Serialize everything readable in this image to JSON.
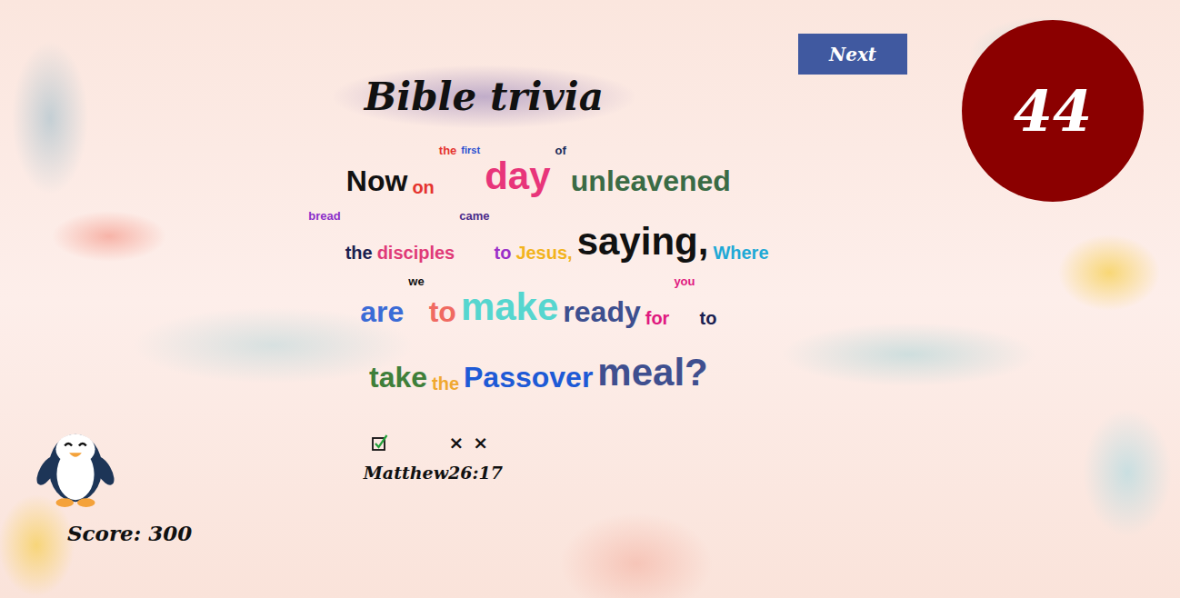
{
  "title": "Bible trivia",
  "next_button": "Next",
  "timer": "44",
  "verse": {
    "lines": [
      [
        {
          "text": "Now",
          "kind": "m",
          "color": "#111111"
        },
        {
          "text": "on",
          "kind": "s",
          "color": "#e5342f"
        },
        {
          "text": "the",
          "kind": "xs",
          "color": "#e5342f"
        },
        {
          "text": "first",
          "kind": "xxs",
          "color": "#2a4fd0"
        },
        {
          "text": "day",
          "kind": "l",
          "color": "#e8357a"
        },
        {
          "text": "of",
          "kind": "xs",
          "color": "#1a2a5a"
        },
        {
          "text": "unleavened",
          "kind": "m",
          "color": "#3a6b45"
        }
      ],
      [
        {
          "text": "bread",
          "kind": "xs",
          "color": "#8b2fc9"
        },
        {
          "text": "the",
          "kind": "s",
          "color": "#1a2050"
        },
        {
          "text": "disciples",
          "kind": "s",
          "color": "#e03a78"
        },
        {
          "text": "came",
          "kind": "xs",
          "color": "#4a2a8a"
        },
        {
          "text": "to",
          "kind": "s",
          "color": "#9b30c8"
        },
        {
          "text": "Jesus,",
          "kind": "s",
          "color": "#f2b41d"
        },
        {
          "text": "saying,",
          "kind": "l",
          "color": "#111111"
        },
        {
          "text": "Where",
          "kind": "s",
          "color": "#1fa9d6"
        }
      ],
      [
        {
          "text": "are",
          "kind": "m",
          "color": "#3a6bd6"
        },
        {
          "text": "we",
          "kind": "xs",
          "color": "#111111"
        },
        {
          "text": "to",
          "kind": "m",
          "color": "#f06b62"
        },
        {
          "text": "make",
          "kind": "l",
          "color": "#56d6cf"
        },
        {
          "text": "ready",
          "kind": "m",
          "color": "#3d4f8f"
        },
        {
          "text": "for",
          "kind": "s",
          "color": "#e0197f"
        },
        {
          "text": "you",
          "kind": "xs",
          "color": "#e0197f"
        },
        {
          "text": "to",
          "kind": "s",
          "color": "#1a2050"
        }
      ],
      [
        {
          "text": "take",
          "kind": "m",
          "color": "#3f7f3a"
        },
        {
          "text": "the",
          "kind": "s",
          "color": "#f0a830"
        },
        {
          "text": "Passover",
          "kind": "m",
          "color": "#1e5ad6"
        },
        {
          "text": "meal?",
          "kind": "l",
          "color": "#3f4f8f"
        }
      ]
    ]
  },
  "attempts": [
    {
      "kind": "correct",
      "mark": ""
    },
    {
      "kind": "wrong",
      "mark": "×"
    },
    {
      "kind": "wrong",
      "mark": "×"
    }
  ],
  "reference": {
    "book": "Matthew",
    "chapter_verse": "26:17"
  },
  "score": "Score: 300"
}
